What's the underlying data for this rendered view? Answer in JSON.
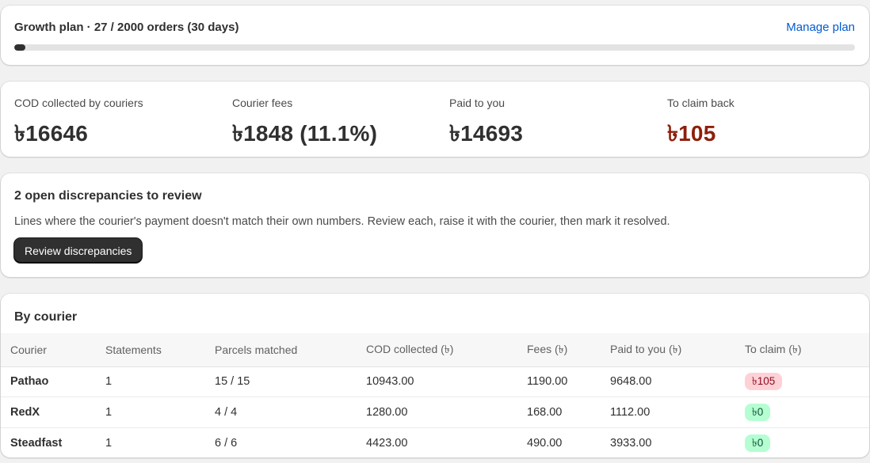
{
  "plan": {
    "title": "Growth plan · 27 / 2000 orders (30 days)",
    "manage_label": "Manage plan",
    "orders_used": 27,
    "orders_limit": 2000
  },
  "stats": [
    {
      "label": "COD collected by couriers",
      "value": "৳16646",
      "tone": "normal"
    },
    {
      "label": "Courier fees",
      "value": "৳1848 (11.1%)",
      "tone": "normal"
    },
    {
      "label": "Paid to you",
      "value": "৳14693",
      "tone": "normal"
    },
    {
      "label": "To claim back",
      "value": "৳105",
      "tone": "danger",
      "color": "#8e1f0b"
    }
  ],
  "discrepancies": {
    "title": "2 open discrepancies to review",
    "description": "Lines where the courier's payment doesn't match their own numbers. Review each, raise it with the courier, then mark it resolved.",
    "button_label": "Review discrepancies"
  },
  "by_courier": {
    "title": "By courier",
    "columns": [
      "Courier",
      "Statements",
      "Parcels matched",
      "COD collected (৳)",
      "Fees (৳)",
      "Paid to you (৳)",
      "To claim (৳)"
    ],
    "rows": [
      {
        "courier": "Pathao",
        "statements": "1",
        "parcels": "15 / 15",
        "cod": "10943.00",
        "fees": "1190.00",
        "paid": "9648.00",
        "claim": "৳105",
        "claim_status": "bad"
      },
      {
        "courier": "RedX",
        "statements": "1",
        "parcels": "4 / 4",
        "cod": "1280.00",
        "fees": "168.00",
        "paid": "1112.00",
        "claim": "৳0",
        "claim_status": "good"
      },
      {
        "courier": "Steadfast",
        "statements": "1",
        "parcels": "6 / 6",
        "cod": "4423.00",
        "fees": "490.00",
        "paid": "3933.00",
        "claim": "৳0",
        "claim_status": "good"
      }
    ]
  },
  "colors": {
    "accent_link": "#005bd3",
    "danger_text": "#8e1f0b",
    "badge_bad_bg": "#fed1d7",
    "badge_good_bg": "#b4fed2"
  }
}
